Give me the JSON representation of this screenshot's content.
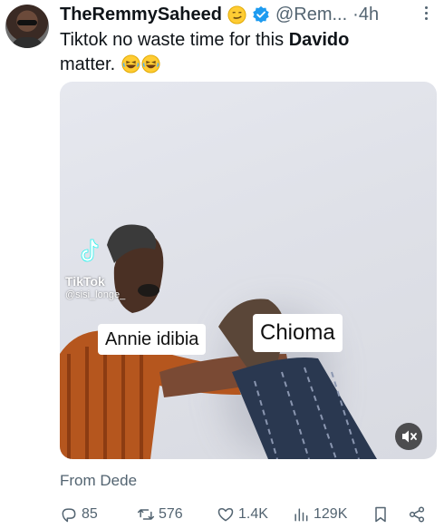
{
  "author": {
    "display_name": "TheRemmySaheed",
    "handle": "@Rem...",
    "time": "4h",
    "time_sep": "·"
  },
  "tweet": {
    "text_part1": "Tiktok no waste time for this ",
    "text_bold": "Davido",
    "text_part2": " matter."
  },
  "media": {
    "platform_label": "TikTok",
    "platform_user": "@sisi_longe_",
    "caption_left": "Annie idibia",
    "caption_right": "Chioma"
  },
  "source": "From Dede",
  "stats": {
    "replies": "85",
    "retweets": "576",
    "likes": "1.4K",
    "views": "129K"
  },
  "icons": [
    "smirk-emoji-icon",
    "verified-badge-icon",
    "more-options-icon",
    "laughing-emoji-icon",
    "tiktok-logo-icon",
    "mute-icon",
    "reply-icon",
    "retweet-icon",
    "like-icon",
    "views-icon",
    "bookmark-icon",
    "share-icon"
  ],
  "colors": {
    "verified": "#1d9bf0",
    "muted_text": "#536471",
    "text": "#0f1419"
  }
}
